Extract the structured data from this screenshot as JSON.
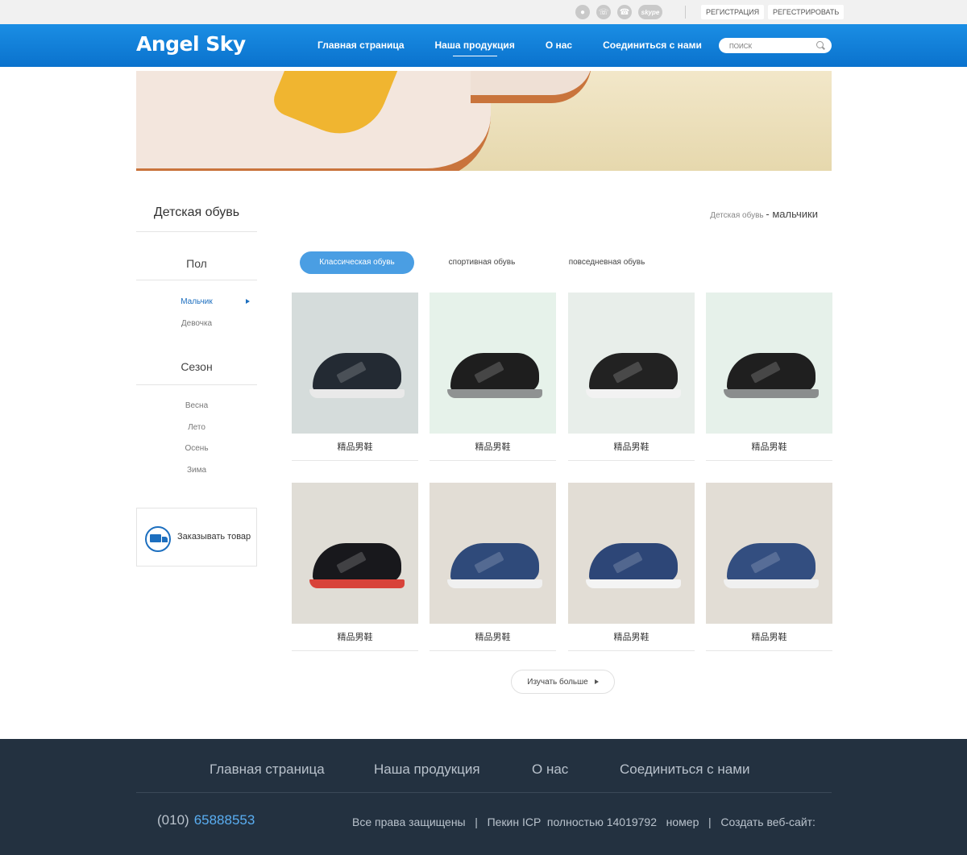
{
  "topbar": {
    "social": [
      "wechat-icon",
      "whatsapp-icon",
      "viber-icon",
      "skype-icon"
    ],
    "skype_label": "skype",
    "register_label": "РЕГИСТРАЦИЯ",
    "signup_label": "РЕГЕСТРИРОВАТЬ"
  },
  "header": {
    "logo": "Angel Sky",
    "nav": [
      "Главная страница",
      "Наша продукция",
      "О нас",
      "Соединиться с нами"
    ],
    "active_nav": "Наша продукция",
    "search_placeholder": "ПОИСК"
  },
  "sidebar": {
    "title": "Детская  обувь",
    "gender_heading": "Пол",
    "gender_items": [
      "Мальчик",
      "Девочка"
    ],
    "season_heading": "Сезон",
    "season_items": [
      "Весна",
      "Лето",
      "Осень",
      "Зима"
    ],
    "order_label": "Заказывать товар"
  },
  "breadcrumb": {
    "parent": "Детская обувь",
    "current": "- мальчики"
  },
  "tabs": [
    "Классическая обувь",
    "спортивная обувь",
    "повседневная обувь"
  ],
  "products": [
    {
      "name": "精品男鞋",
      "bg": "#d5dcdb",
      "upper": "#232a33",
      "sole": "#e9e9e9"
    },
    {
      "name": "精品男鞋",
      "bg": "#e6f2ea",
      "upper": "#1e1e1e",
      "sole": "#8f9292"
    },
    {
      "name": "精品男鞋",
      "bg": "#e8eeea",
      "upper": "#222222",
      "sole": "#f2f2f2"
    },
    {
      "name": "精品男鞋",
      "bg": "#e6f1ea",
      "upper": "#1f1f1f",
      "sole": "#8a8d8d"
    },
    {
      "name": "精品男鞋",
      "bg": "#e0ddd6",
      "upper": "#18181c",
      "sole": "#d8433a"
    },
    {
      "name": "精品男鞋",
      "bg": "#e2ddd5",
      "upper": "#2f4a7a",
      "sole": "#f0f0f0"
    },
    {
      "name": "精品男鞋",
      "bg": "#e2ddd5",
      "upper": "#2d4677",
      "sole": "#f4f4f4"
    },
    {
      "name": "精品男鞋",
      "bg": "#e2ddd5",
      "upper": "#334e80",
      "sole": "#f0f0f0"
    }
  ],
  "more_label": "Изучать больше",
  "footer": {
    "nav": [
      "Главная страница",
      "Наша продукция",
      "О нас",
      "Соединиться с нами"
    ],
    "phone_code": "(010)",
    "phone_number": "65888553",
    "copyright": "Все права защищены   |   Пекин ICP  полностью 14019792   номер   |   Создать веб-сайт:"
  }
}
